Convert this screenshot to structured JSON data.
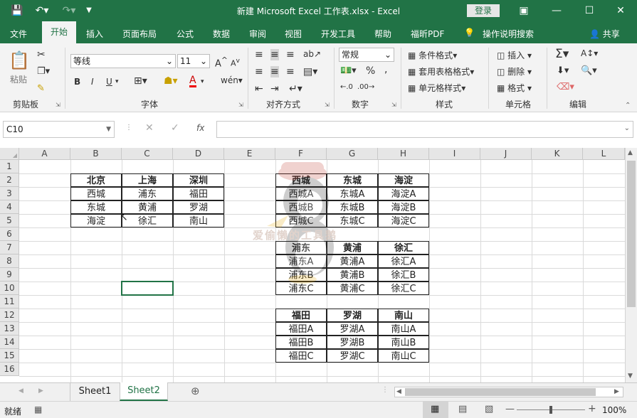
{
  "window": {
    "title": "新建 Microsoft Excel 工作表.xlsx  -  Excel",
    "login_label": "登录"
  },
  "ribbon_tabs": [
    "文件",
    "开始",
    "插入",
    "页面布局",
    "公式",
    "数据",
    "审阅",
    "视图",
    "开发工具",
    "帮助",
    "福昕PDF",
    "操作说明搜索",
    "共享"
  ],
  "ribbon": {
    "clipboard": {
      "paste_label": "粘贴",
      "group_label": "剪贴板"
    },
    "font": {
      "font_name": "等线",
      "font_size": "11",
      "group_label": "字体",
      "bold": "B",
      "italic": "I",
      "underline": "U"
    },
    "alignment": {
      "group_label": "对齐方式"
    },
    "number": {
      "format": "常规",
      "group_label": "数字",
      "percent": "%",
      "comma": ","
    },
    "styles": {
      "conditional": "条件格式",
      "table": "套用表格格式",
      "cell": "单元格样式",
      "group_label": "样式"
    },
    "cells": {
      "insert": "插入",
      "delete": "删除",
      "format": "格式",
      "group_label": "单元格"
    },
    "editing": {
      "group_label": "编辑"
    }
  },
  "formula_bar": {
    "name_box": "C10",
    "fx": "fx",
    "formula": ""
  },
  "columns": [
    "A",
    "B",
    "C",
    "D",
    "E",
    "F",
    "G",
    "H",
    "I",
    "J",
    "K",
    "L"
  ],
  "rows": [
    "1",
    "2",
    "3",
    "4",
    "5",
    "6",
    "7",
    "8",
    "9",
    "10",
    "11",
    "12",
    "13",
    "14",
    "15",
    "16"
  ],
  "table_left": {
    "headers": [
      "北京",
      "上海",
      "深圳"
    ],
    "rows": [
      [
        "西城",
        "浦东",
        "福田"
      ],
      [
        "东城",
        "黄浦",
        "罗湖"
      ],
      [
        "海淀",
        "徐汇",
        "南山"
      ]
    ]
  },
  "tables_right": [
    {
      "headers": [
        "西城",
        "东城",
        "海淀"
      ],
      "rows": [
        [
          "西城A",
          "东城A",
          "海淀A"
        ],
        [
          "西城B",
          "东城B",
          "海淀B"
        ],
        [
          "西城C",
          "东城C",
          "海淀C"
        ]
      ]
    },
    {
      "headers": [
        "浦东",
        "黄浦",
        "徐汇"
      ],
      "rows": [
        [
          "浦东A",
          "黄浦A",
          "徐汇A"
        ],
        [
          "浦东B",
          "黄浦B",
          "徐汇B"
        ],
        [
          "浦东C",
          "黄浦C",
          "徐汇C"
        ]
      ]
    },
    {
      "headers": [
        "福田",
        "罗湖",
        "南山"
      ],
      "rows": [
        [
          "福田A",
          "罗湖A",
          "南山A"
        ],
        [
          "福田B",
          "罗湖B",
          "南山B"
        ],
        [
          "福田C",
          "罗湖C",
          "南山C"
        ]
      ]
    }
  ],
  "watermark_text": "爱偷懒的工具鹅",
  "sheets": [
    "Sheet1",
    "Sheet2"
  ],
  "active_sheet": "Sheet2",
  "status": {
    "ready": "就绪",
    "zoom": "100%"
  },
  "colors": {
    "accent": "#217346"
  }
}
